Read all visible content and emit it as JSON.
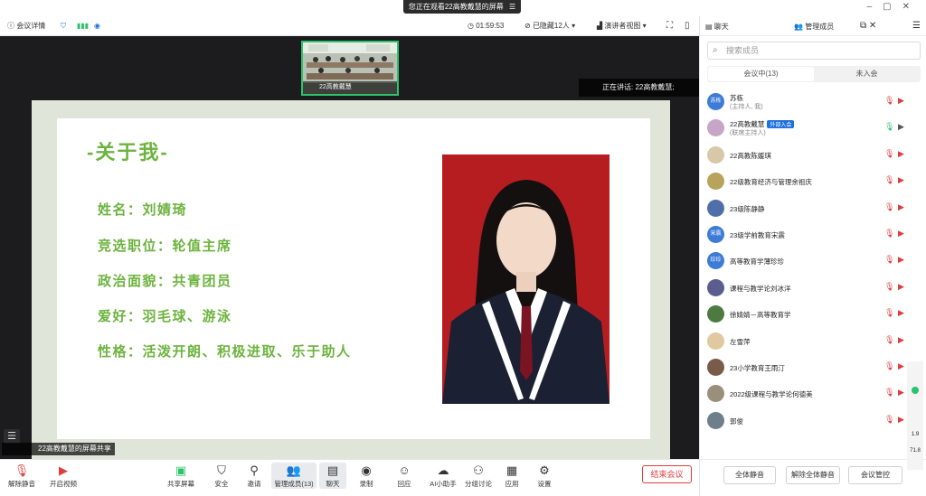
{
  "banner": {
    "text": "您正在观看22高教戴慧的屏幕",
    "menu_icon": "menu-icon"
  },
  "toolbar": {
    "meeting_details": "会议详情",
    "time": "01:59:53",
    "hidden_count": "已隐藏12人",
    "view_mode": "演讲者视图"
  },
  "stage": {
    "thumb_name": "22高教戴慧",
    "speaking_label": "正在讲话:",
    "speaking_name": "22高教戴慧;",
    "share_tag": "22高教戴慧的屏幕共享"
  },
  "slide": {
    "title": "-关于我-",
    "lines": [
      "姓名：刘婧琦",
      "竞选职位：轮值主席",
      "政治面貌：共青团员",
      "爱好：羽毛球、游泳",
      "性格：活泼开朗、积极进取、乐于助人"
    ]
  },
  "bottom_bar": {
    "unmute": "解除静音",
    "start_video": "开启视频",
    "share_screen": "共享屏幕",
    "security": "安全",
    "invite": "邀请",
    "manage_members": "管理成员(13)",
    "chat": "聊天",
    "record": "录制",
    "reactions": "回应",
    "ai_assistant": "AI小助手",
    "breakout": "分组讨论",
    "apps": "应用",
    "settings": "设置",
    "end_meeting": "结束会议"
  },
  "panel": {
    "chat_tab": "聊天",
    "members_tab": "管理成员",
    "search_placeholder": "搜索成员",
    "in_meeting": "会议中(13)",
    "not_joined": "未入会",
    "members": [
      {
        "name": "苏栋",
        "sub": "(主持人, 我)",
        "avatar": "苏栋",
        "color": "#3d7bd6"
      },
      {
        "name": "22高教戴慧",
        "sub": "(联席主持人)",
        "avatar": "",
        "color": "#c7a5c8",
        "badge": "外部入会"
      },
      {
        "name": "22高教陈媛琪",
        "sub": "",
        "avatar": "",
        "color": "#d8c7a8"
      },
      {
        "name": "22级教育经济与管理余祖庆",
        "sub": "",
        "avatar": "",
        "color": "#b8a35b"
      },
      {
        "name": "23级陈静静",
        "sub": "",
        "avatar": "",
        "color": "#4f6fa8"
      },
      {
        "name": "23级学前教育宋震",
        "sub": "",
        "avatar": "宋震",
        "color": "#3d7bd6"
      },
      {
        "name": "高等教育学薄珍珍",
        "sub": "",
        "avatar": "珍珍",
        "color": "#3d7bd6"
      },
      {
        "name": "课程与教学论刘冰洋",
        "sub": "",
        "avatar": "",
        "color": "#5b5d8e"
      },
      {
        "name": "徐婧婧－高等教育学",
        "sub": "",
        "avatar": "",
        "color": "#4c7a3f"
      },
      {
        "name": "左雪萍",
        "sub": "",
        "avatar": "",
        "color": "#e0c9a0"
      },
      {
        "name": "23小学教育王雨汀",
        "sub": "",
        "avatar": "",
        "color": "#7a5b4a"
      },
      {
        "name": "2022级课程与教学论何德美",
        "sub": "",
        "avatar": "",
        "color": "#9a8f7a"
      },
      {
        "name": "郭俊",
        "sub": "",
        "avatar": "",
        "color": "#6e7f8c"
      }
    ],
    "mute_all": "全体静音",
    "unmute_all": "解除全体静音",
    "meeting_control": "会议管控"
  },
  "side_indicator": {
    "value1": "1.9",
    "value2": "71.8"
  }
}
